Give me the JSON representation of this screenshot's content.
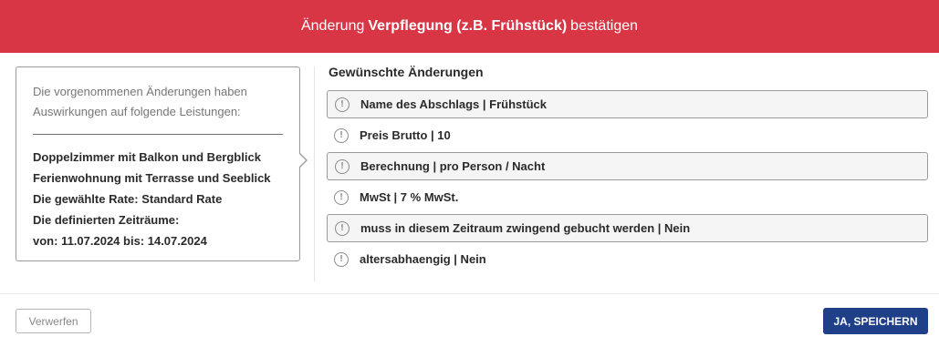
{
  "header": {
    "prefix": "Änderung",
    "strong": "Verpflegung (z.B. Frühstück)",
    "suffix": "bestätigen"
  },
  "impact": {
    "intro_line1": "Die vorgenommenen Änderungen haben",
    "intro_line2": "Auswirkungen auf folgende Leistungen:",
    "items": [
      "Doppelzimmer mit Balkon und Bergblick",
      "Ferienwohnung mit Terrasse und Seeblick",
      "Die gewählte Rate: Standard Rate",
      "Die definierten Zeiträume:",
      "von: 11.07.2024 bis: 14.07.2024"
    ]
  },
  "changes": {
    "title": "Gewünschte Änderungen",
    "rows": [
      "Name des Abschlags | Frühstück",
      "Preis Brutto | 10",
      "Berechnung | pro Person / Nacht",
      "MwSt | 7 % MwSt.",
      "muss in diesem Zeitraum zwingend gebucht werden | Nein",
      "altersabhaengig | Nein"
    ],
    "icon_glyph": "!"
  },
  "footer": {
    "discard_label": "Verwerfen",
    "save_label": "JA, SPEICHERN"
  },
  "colors": {
    "header_bg": "#d83545",
    "save_bg": "#1f3f88"
  },
  "icons": {
    "row_icon": "info-exclamation-icon"
  }
}
